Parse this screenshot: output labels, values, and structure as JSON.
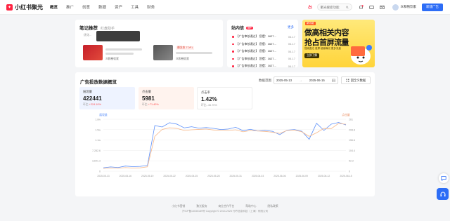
{
  "colors": {
    "brand": "#ff2442",
    "primary": "#2d6df6",
    "series_a": "#5b8ff9",
    "series_b": "#f7b98b"
  },
  "header": {
    "logo_text": "小红书聚光",
    "nav": [
      "概览",
      "推广",
      "创意",
      "数据",
      "资产",
      "工具",
      "财务"
    ],
    "search_placeholder": "聚光搜索功能",
    "username": "众和畅饮家",
    "cta_label": "新建广告"
  },
  "notes": {
    "title": "笔记推荐",
    "subtitle": "红盘助手",
    "tag": "优化...",
    "item1_author": "众和畅饮家",
    "item2_badge": "爆发款 TOP1",
    "item2_author": "众和畅饮家"
  },
  "messages": {
    "title": "站内信",
    "badge": "99+",
    "more_label": "更多",
    "items": [
      {
        "text": "【广告审核通过】 您摆：1627...",
        "date": "06-17"
      },
      {
        "text": "【广告审核通过】 您摆：1627...",
        "date": "06-17"
      },
      {
        "text": "【广告审核通过】 您摆：1627...",
        "date": "06-17"
      },
      {
        "text": "【广告审核通过】 您摆：1627...",
        "date": "06-17"
      },
      {
        "text": "【广告审核通过】 您摆：1627...",
        "date": "06-17"
      }
    ]
  },
  "ad_banner": {
    "tag": "新功能",
    "line1": "做高相关内容",
    "line2": "抢占首屏流量",
    "sub": "搜索直达 首屏 超高曝光 更多流量",
    "chip": "立即了解"
  },
  "stats": {
    "title": "广告投放数据概览",
    "range_label": "数据范围",
    "start_date": "2025-05-13",
    "end_date": "2025-06-15",
    "back_label": "回全义数据",
    "kpis": [
      {
        "label": "展现量",
        "value": "422441",
        "delta_prefix": "环比",
        "delta": "+224.10%"
      },
      {
        "label": "点击量",
        "value": "5981",
        "delta_prefix": "环比",
        "delta": "+71.40%"
      },
      {
        "label": "点击率",
        "value": "1.42%",
        "delta_prefix": "环比",
        "delta": "-46.70%"
      }
    ]
  },
  "chart_data": {
    "type": "line",
    "x": [
      "2025-05-13",
      "2025-05-14",
      "2025-05-15",
      "2025-05-16",
      "2025-05-17",
      "2025-05-18",
      "2025-05-19",
      "2025-05-20",
      "2025-05-21",
      "2025-05-22",
      "2025-05-23",
      "2025-05-24",
      "2025-05-25",
      "2025-05-26",
      "2025-05-27",
      "2025-05-28",
      "2025-05-29",
      "2025-05-30",
      "2025-05-31",
      "2025-06-01",
      "2025-06-02",
      "2025-06-03",
      "2025-06-04",
      "2025-06-05",
      "2025-06-06",
      "2025-06-07",
      "2025-06-08",
      "2025-06-09",
      "2025-06-10",
      "2025-06-11",
      "2025-06-12",
      "2025-06-13",
      "2025-06-14",
      "2025-06-15"
    ],
    "x_ticks": [
      "2025-05-13",
      "2025-05-16",
      "2025-05-19",
      "2025-05-22",
      "2025-05-25",
      "2025-05-28",
      "2025-05-31",
      "2025-06-03",
      "2025-06-06",
      "2025-06-09",
      "2025-06-12",
      "2025-06-15"
    ],
    "y_left_label": "展现量",
    "y_left_ticks": [
      "0",
      "3,641.3",
      "7,282.6",
      "1.1w",
      "1.5w",
      "1.8w"
    ],
    "y_left_lim": [
      0,
      18206.5
    ],
    "y_right_label": "点击量",
    "y_right_ticks": [
      "0",
      "52.2",
      "104.4",
      "156.6",
      "208.8",
      "261"
    ],
    "y_right_lim": [
      0,
      261
    ],
    "series": [
      {
        "values": [
          1200,
          1500,
          1300,
          1800,
          1600,
          1700,
          2000,
          16000,
          15500,
          17000,
          16500,
          15200,
          15600,
          15100,
          15300,
          15000,
          14600,
          14800,
          15400,
          14200,
          14700,
          14100,
          14300,
          14000,
          12800,
          14400,
          14600,
          14000,
          11200,
          16800,
          14300,
          16500,
          17100,
          16200
        ]
      },
      {
        "values": [
          14,
          16,
          15,
          18,
          16,
          17,
          22,
          175,
          210,
          218,
          215,
          205,
          208,
          210,
          212,
          207,
          206,
          205,
          208,
          198,
          204,
          202,
          200,
          196,
          190,
          205,
          207,
          198,
          175,
          193,
          215,
          214,
          240,
          236
        ]
      }
    ]
  },
  "footer": {
    "links": [
      "小红书营销",
      "聚光服务",
      "商业合作平台",
      "帮助中心",
      "隐私政策"
    ],
    "copyright": "沪ICP备13030189号 Copyright © 2014-2025 行吟信息科技（上海）有限公司"
  }
}
